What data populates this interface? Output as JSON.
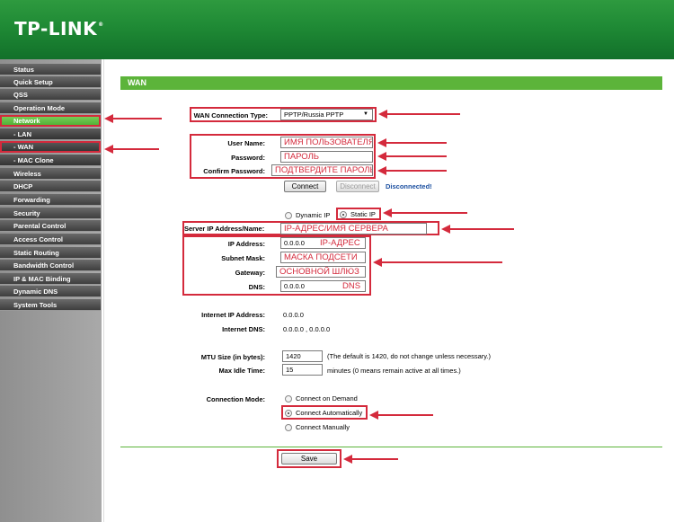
{
  "header": {
    "logo": "TP-LINK",
    "logo_mark": "®"
  },
  "sidebar": {
    "items": [
      {
        "label": "Status"
      },
      {
        "label": "Quick Setup"
      },
      {
        "label": "QSS"
      },
      {
        "label": "Operation Mode"
      },
      {
        "label": "Network"
      },
      {
        "label": "- LAN"
      },
      {
        "label": "- WAN"
      },
      {
        "label": "- MAC Clone"
      },
      {
        "label": "Wireless"
      },
      {
        "label": "DHCP"
      },
      {
        "label": "Forwarding"
      },
      {
        "label": "Security"
      },
      {
        "label": "Parental Control"
      },
      {
        "label": "Access Control"
      },
      {
        "label": "Static Routing"
      },
      {
        "label": "Bandwidth Control"
      },
      {
        "label": "IP & MAC Binding"
      },
      {
        "label": "Dynamic DNS"
      },
      {
        "label": "System Tools"
      }
    ]
  },
  "main": {
    "title": "WAN",
    "wan_type": {
      "label": "WAN Connection Type:",
      "value": "PPTP/Russia PPTP"
    },
    "username": {
      "label": "User Name:",
      "value": "ИМЯ ПОЛЬЗОВАТЕЛЯ"
    },
    "password": {
      "label": "Password:",
      "value": "ПАРОЛЬ"
    },
    "confirm": {
      "label": "Confirm Password:",
      "value": "ПОДТВЕРДИТЕ ПАРОЛЬ"
    },
    "connect_label": "Connect",
    "disconnect_label": "Disconnect",
    "status": "Disconnected!",
    "dynamic_ip": "Dynamic IP",
    "static_ip": "Static IP",
    "server": {
      "label": "Server IP Address/Name:",
      "value": "IP-АДРЕС/ИМЯ СЕРВЕРА"
    },
    "ip": {
      "label": "IP Address:",
      "value": "0.0.0.0",
      "note": "IP-АДРЕС"
    },
    "mask": {
      "label": "Subnet Mask:",
      "value": "МАСКА ПОДСЕТИ"
    },
    "gateway": {
      "label": "Gateway:",
      "value": "ОСНОВНОЙ ШЛЮЗ"
    },
    "dns": {
      "label": "DNS:",
      "value": "0.0.0.0",
      "note": "DNS"
    },
    "internet_ip": {
      "label": "Internet IP Address:",
      "value": "0.0.0.0"
    },
    "internet_dns": {
      "label": "Internet DNS:",
      "value": "0.0.0.0 , 0.0.0.0"
    },
    "mtu": {
      "label": "MTU Size (in bytes):",
      "value": "1420",
      "hint": "(The default is 1420, do not change unless necessary.)"
    },
    "idle": {
      "label": "Max Idle Time:",
      "value": "15",
      "hint": "minutes (0 means remain active at all times.)"
    },
    "mode": {
      "label": "Connection Mode:",
      "options": [
        "Connect on Demand",
        "Connect Automatically",
        "Connect Manually"
      ]
    },
    "save_label": "Save"
  },
  "colors": {
    "brand_green": "#1f8a35",
    "accent_green": "#5cb43a",
    "annotation_red": "#d42a3c"
  }
}
